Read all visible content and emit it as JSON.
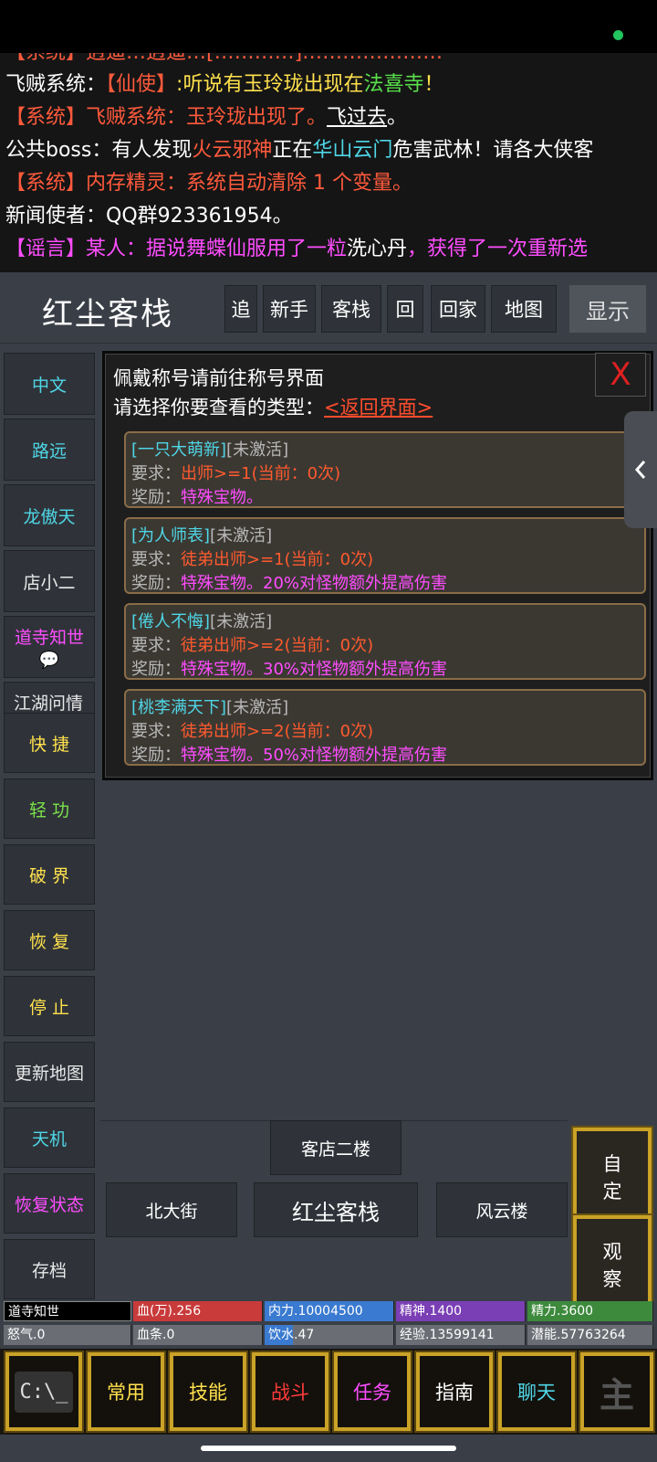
{
  "chat": {
    "line0": "【系统】逍遥…逍遥…[…………]…………………",
    "line1": {
      "a": "飞贼系统：",
      "b": "【仙使】",
      "c": ":听说有玉玲珑出现在",
      "d": "法喜寺",
      "e": "！"
    },
    "line2": {
      "a": "【系统】飞贼系统：玉玲珑出现了。",
      "b": "飞过去",
      "c": "。"
    },
    "line3": {
      "a": "公共boss：有人发现",
      "b": "火云邪神",
      "c": "正在",
      "d": "华山云门",
      "e": "危害武林！请各大侠客"
    },
    "line4": "【系统】内存精灵：系统自动清除 1 个变量。",
    "line5": "新闻使者：QQ群923361954。",
    "line6": {
      "a": "【谣言】某人：据说舞蝶仙服用了一粒",
      "b": "洗心丹",
      "c": "，获得了一次重新选"
    }
  },
  "header": {
    "room_title": "红尘客栈",
    "nav": [
      "追",
      "新手",
      "客栈",
      "回",
      "回家",
      "地图"
    ],
    "show_label": "显示"
  },
  "sidebar": [
    {
      "label": "中文",
      "color": "#4fd6e6"
    },
    {
      "label": "路远",
      "color": "#4fd6e6"
    },
    {
      "label": "龙傲天",
      "color": "#4fd6e6"
    },
    {
      "label": "店小二",
      "color": "#e8e8e8"
    },
    {
      "label": "道寺知世",
      "color": "#ff4dff",
      "sub": "💬"
    },
    {
      "label": "江湖问情",
      "color": "#e8e8e8"
    },
    {
      "label": "快 捷",
      "color": "#ffe14d"
    },
    {
      "label": "轻 功",
      "color": "#7be04b"
    },
    {
      "label": "破 界",
      "color": "#ffe14d"
    },
    {
      "label": "恢 复",
      "color": "#ffe14d"
    },
    {
      "label": "停 止",
      "color": "#ffe14d"
    },
    {
      "label": "更新地图",
      "color": "#e8e8e8"
    },
    {
      "label": "天机",
      "color": "#4fd6e6"
    },
    {
      "label": "恢复状态",
      "color": "#ff4dff"
    },
    {
      "label": "存档",
      "color": "#e8e8e8"
    }
  ],
  "panel": {
    "line1": "佩戴称号请前往称号界面",
    "line2": "请选择你要查看的类型：",
    "back_link": "<返回界面>",
    "close": "X",
    "titles": [
      {
        "name": "[一只大萌新]",
        "status": "[未激活]",
        "req_label": "要求：",
        "req": "出师>=1(当前：0次)",
        "rew_label": "奖励：",
        "rew": "特殊宝物。"
      },
      {
        "name": "[为人师表]",
        "status": "[未激活]",
        "req_label": "要求：",
        "req": "徒弟出师>=1(当前：0次)",
        "rew_label": "奖励：",
        "rew": "特殊宝物。20%对怪物额外提高伤害"
      },
      {
        "name": "[倦人不悔]",
        "status": "[未激活]",
        "req_label": "要求：",
        "req": "徒弟出师>=2(当前：0次)",
        "rew_label": "奖励：",
        "rew": "特殊宝物。30%对怪物额外提高伤害"
      },
      {
        "name": "[桃李满天下]",
        "status": "[未激活]",
        "req_label": "要求：",
        "req": "徒弟出师>=2(当前：0次)",
        "rew_label": "奖励：",
        "rew": "特殊宝物。50%对怪物额外提高伤害"
      }
    ]
  },
  "exits": {
    "up": "客店二楼",
    "left": "北大街",
    "center": "红尘客栈",
    "right": "风云楼"
  },
  "actions": {
    "custom": "自定",
    "observe": "观察"
  },
  "stats": {
    "name": "道寺知世",
    "hp": "血(万).256",
    "neili": "内力.10004500",
    "jingshen": "精神.1400",
    "jingli": "精力.3600",
    "nuqi": "怒气.0",
    "xuetiao": "血条.0",
    "yinshui": "饮水.47",
    "jingyan": "经验.13599141",
    "qianneng": "潜能.57763264",
    "yinshui_fill": 0.22
  },
  "tabs": {
    "console": "C:\\_",
    "changyong": "常用",
    "jineng": "技能",
    "zhandou": "战斗",
    "renwu": "任务",
    "zhinan": "指南",
    "liaotian": "聊天",
    "zhu": "主"
  },
  "colors": {
    "accent_gold": "#c9a227",
    "text_red": "#ff5a3c",
    "text_cyan": "#4fd6e6",
    "text_magenta": "#ff4dff",
    "text_yellow": "#ffe14d"
  }
}
